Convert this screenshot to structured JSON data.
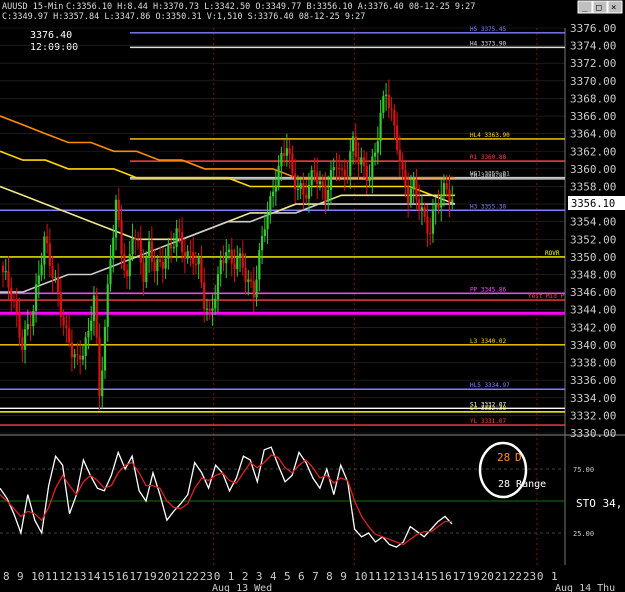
{
  "window": {
    "title_left": "AUUSD 15-Min",
    "stats": "C:3356.10 H:8.44 H:3370.73 L:3342.50 O:3349.77 B:3356.10 A:3376.40 08-12-25 9:27",
    "line2": "C:3349.97 H:3357.84 L:3347.86 O:3350.31 V:1,510 S:3376.40 08-12-25 9:27",
    "cursor_price": "3376.40",
    "cursor_time": "12:09:00",
    "controls": [
      "_",
      "□",
      "×"
    ]
  },
  "colors": {
    "background": "#000000",
    "grid": "#2a2a2a",
    "candle_up": "#2ecc2e",
    "candle_down": "#e01010",
    "axis_text": "#cccccc",
    "stoch_k": "#ffffff",
    "stoch_d": "#e02020"
  },
  "chart_data": [
    {
      "type": "candlestick",
      "instrument": "AUUSD 15-Min",
      "ylim": [
        3330,
        3376
      ],
      "y_ticks": [
        3330,
        3332,
        3334,
        3336,
        3338,
        3340,
        3342,
        3344,
        3346,
        3348,
        3350,
        3352,
        3354,
        3356,
        3358,
        3360,
        3362,
        3364,
        3366,
        3368,
        3370,
        3372,
        3374,
        3376
      ],
      "y_tick_labels": [
        "3330.00",
        "3332.00",
        "3334.00",
        "3336.00",
        "3338.00",
        "3340.00",
        "3342.00",
        "3344.00",
        "3346.00",
        "3348.00",
        "3350.00",
        "3352.00",
        "3354.00",
        "3356.00",
        "3358.00",
        "3360.00",
        "3362.00",
        "3364.00",
        "3366.00",
        "3368.00",
        "3370.00",
        "3372.00",
        "3374.00",
        "3376.00"
      ],
      "last_price_label": "3356.10",
      "x_tick_labels": [
        "8",
        "9",
        "10",
        "11",
        "12",
        "13",
        "14",
        "15",
        "16",
        "17",
        "19",
        "20",
        "21",
        "22",
        "23",
        "0",
        "1",
        "2",
        "3",
        "4",
        "5",
        "6",
        "7",
        "8",
        "9",
        "10",
        "11",
        "12",
        "13",
        "14",
        "15",
        "16",
        "17",
        "19",
        "20",
        "21",
        "22",
        "23",
        "0",
        "1"
      ],
      "date_labels": [
        "Aug 13 Wed",
        "Aug 14 Thu"
      ],
      "session_breaks_at_x_index": [
        15,
        25,
        38
      ],
      "close_path": [
        [
          0,
          3349
        ],
        [
          4,
          3346
        ],
        [
          8,
          3340
        ],
        [
          12,
          3344
        ],
        [
          16,
          3352
        ],
        [
          20,
          3347
        ],
        [
          24,
          3341
        ],
        [
          28,
          3338
        ],
        [
          32,
          3341
        ],
        [
          34,
          3346
        ],
        [
          36,
          3334
        ],
        [
          38,
          3342
        ],
        [
          40,
          3350
        ],
        [
          42,
          3356
        ],
        [
          44,
          3351
        ],
        [
          46,
          3347
        ],
        [
          48,
          3353
        ],
        [
          50,
          3351
        ],
        [
          52,
          3348
        ],
        [
          54,
          3351
        ],
        [
          56,
          3349
        ],
        [
          58,
          3349
        ],
        [
          60,
          3350
        ],
        [
          62,
          3351
        ],
        [
          64,
          3353
        ],
        [
          66,
          3351
        ],
        [
          68,
          3350
        ],
        [
          70,
          3350
        ],
        [
          72,
          3349
        ],
        [
          74,
          3345
        ],
        [
          76,
          3343
        ],
        [
          78,
          3346
        ],
        [
          80,
          3349
        ],
        [
          82,
          3351
        ],
        [
          84,
          3349
        ],
        [
          86,
          3350
        ],
        [
          88,
          3349
        ],
        [
          90,
          3347
        ],
        [
          92,
          3346
        ],
        [
          94,
          3350
        ],
        [
          96,
          3354
        ],
        [
          98,
          3356
        ],
        [
          100,
          3359
        ],
        [
          102,
          3361
        ],
        [
          104,
          3363
        ],
        [
          106,
          3359
        ],
        [
          108,
          3358
        ],
        [
          110,
          3357
        ],
        [
          112,
          3358
        ],
        [
          114,
          3360
        ],
        [
          116,
          3358
        ],
        [
          118,
          3357
        ],
        [
          120,
          3359
        ],
        [
          122,
          3361
        ],
        [
          124,
          3359
        ],
        [
          126,
          3360
        ],
        [
          128,
          3363
        ],
        [
          130,
          3361
        ],
        [
          132,
          3360
        ],
        [
          134,
          3359
        ],
        [
          136,
          3362
        ],
        [
          138,
          3366
        ],
        [
          140,
          3369
        ],
        [
          142,
          3366
        ],
        [
          144,
          3363
        ],
        [
          146,
          3359
        ],
        [
          148,
          3357
        ],
        [
          150,
          3358
        ],
        [
          152,
          3356
        ],
        [
          154,
          3354
        ],
        [
          156,
          3353
        ],
        [
          158,
          3356
        ],
        [
          160,
          3357
        ],
        [
          162,
          3358
        ],
        [
          164,
          3356
        ]
      ],
      "moving_averages": [
        {
          "color": "#ff8c00",
          "values": [
            3366,
            3365,
            3364,
            3363,
            3363,
            3362,
            3362,
            3361,
            3361,
            3360,
            3360,
            3360,
            3360,
            3359,
            3359,
            3359,
            3359,
            3359,
            3359,
            3359,
            3359
          ]
        },
        {
          "color": "#ffd700",
          "values": [
            3362,
            3361,
            3361,
            3360,
            3360,
            3360,
            3359,
            3359,
            3359,
            3359,
            3359,
            3358,
            3358,
            3358,
            3358,
            3358,
            3358,
            3358,
            3358,
            3357,
            3357
          ]
        },
        {
          "color": "#f0e68c",
          "values": [
            3358,
            3357,
            3356,
            3355,
            3354,
            3353,
            3352,
            3352,
            3352,
            3353,
            3354,
            3355,
            3355,
            3356,
            3356,
            3357,
            3357,
            3357,
            3357,
            3357,
            3356
          ]
        },
        {
          "color": "#cccccc",
          "values": [
            3346,
            3346,
            3347,
            3348,
            3348,
            3349,
            3350,
            3351,
            3352,
            3353,
            3354,
            3354,
            3355,
            3355,
            3356,
            3356,
            3356,
            3356,
            3356,
            3356,
            3356
          ]
        }
      ],
      "levels": [
        {
          "label": "H5 3375.45",
          "value": 3375.45,
          "color": "#8080ff"
        },
        {
          "label": "H4 3373.90",
          "value": 3373.8,
          "color": "#dddddd"
        },
        {
          "label": "HL4 3363.90",
          "value": 3363.4,
          "color": "#ffd700"
        },
        {
          "label": "R1 3360.88",
          "value": 3360.88,
          "color": "#ff4040"
        },
        {
          "label": "YH 3358.86",
          "value": 3358.86,
          "color": "#cccccc"
        },
        {
          "label": "HS1 3359.01",
          "value": 3359.01,
          "color": "#cccccc"
        },
        {
          "label": "H3 3355.30",
          "value": 3355.3,
          "color": "#8080ff"
        },
        {
          "label": "ROVR",
          "value": 3350.0,
          "color": "#ffff00"
        },
        {
          "label": "PP 3345.86",
          "value": 3345.86,
          "color": "#ff40ff"
        },
        {
          "label": "Yest Mid P",
          "value": 3345.1,
          "color": "#ff4040"
        },
        {
          "label": "",
          "value": 3343.6,
          "color": "#ff00ff"
        },
        {
          "label": "L3 3340.02",
          "value": 3340.02,
          "color": "#ffd700"
        },
        {
          "label": "HL5 3334.97",
          "value": 3334.97,
          "color": "#8080ff"
        },
        {
          "label": "S1 3332.07",
          "value": 3332.8,
          "color": "#ffffff"
        },
        {
          "label": "L4 3332.38",
          "value": 3332.4,
          "color": "#ffff00"
        },
        {
          "label": "YL 3331.07",
          "value": 3330.9,
          "color": "#ff4040"
        }
      ]
    },
    {
      "type": "line",
      "indicator": "STO 34,",
      "y_tick_labels": [
        "75.00",
        "25.00"
      ],
      "y_ticks": [
        75,
        25
      ],
      "ylim": [
        0,
        100
      ],
      "annotation_value": "28",
      "annotation_suffix": "D",
      "range_label": "28 Range",
      "series": [
        {
          "color": "#ffffff",
          "values": [
            60,
            52,
            40,
            25,
            55,
            35,
            25,
            62,
            85,
            78,
            40,
            55,
            82,
            70,
            60,
            58,
            70,
            88,
            75,
            85,
            58,
            50,
            72,
            55,
            35,
            42,
            48,
            55,
            80,
            72,
            60,
            78,
            72,
            58,
            68,
            85,
            82,
            65,
            90,
            92,
            78,
            65,
            70,
            88,
            80,
            68,
            60,
            75,
            55,
            78,
            65,
            28,
            22,
            25,
            18,
            22,
            16,
            14,
            18,
            30,
            26,
            22,
            28,
            34,
            38,
            32
          ]
        },
        {
          "color": "#e02020",
          "values": [
            55,
            50,
            44,
            38,
            42,
            40,
            35,
            45,
            60,
            70,
            62,
            55,
            65,
            70,
            66,
            60,
            62,
            72,
            78,
            80,
            72,
            62,
            62,
            60,
            50,
            45,
            44,
            48,
            60,
            68,
            66,
            70,
            72,
            66,
            64,
            72,
            80,
            76,
            80,
            86,
            84,
            76,
            72,
            78,
            82,
            76,
            68,
            70,
            64,
            68,
            66,
            50,
            38,
            30,
            24,
            22,
            20,
            18,
            16,
            20,
            24,
            26,
            26,
            30,
            34,
            34
          ]
        }
      ]
    }
  ]
}
